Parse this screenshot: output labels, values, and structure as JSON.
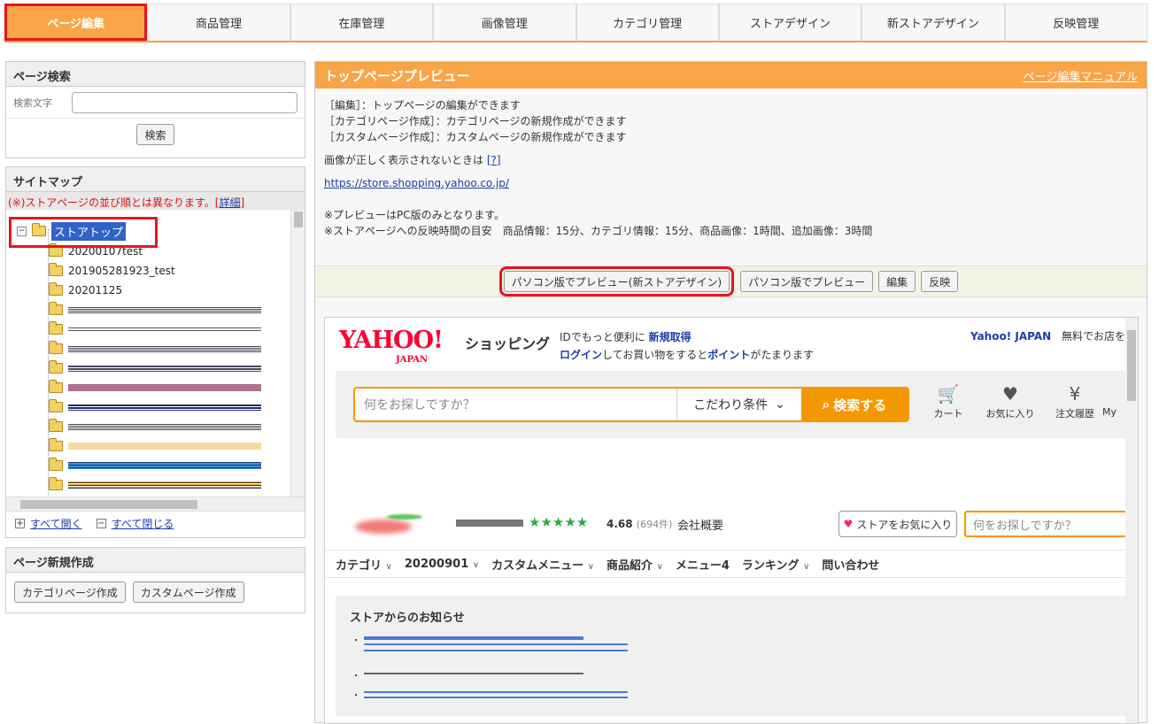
{
  "topnav": {
    "tabs": [
      {
        "label": "ページ編集",
        "active": true
      },
      {
        "label": "商品管理"
      },
      {
        "label": "在庫管理"
      },
      {
        "label": "画像管理"
      },
      {
        "label": "カテゴリ管理"
      },
      {
        "label": "ストアデザイン"
      },
      {
        "label": "新ストアデザイン"
      },
      {
        "label": "反映管理"
      }
    ]
  },
  "page_search": {
    "title": "ページ検索",
    "label": "検索文字",
    "input_value": "",
    "button": "検索"
  },
  "sitemap": {
    "title": "サイトマップ",
    "warning": "(※)ストアページの並び順とは異なります。",
    "detail_link": "詳細",
    "root": "ストアトップ",
    "items": [
      "20200107test",
      "201905281923_test",
      "20201125"
    ],
    "expand_all": "すべて開く",
    "collapse_all": "すべて閉じる"
  },
  "new_page": {
    "title": "ページ新規作成",
    "category_btn": "カテゴリページ作成",
    "custom_btn": "カスタムページ作成"
  },
  "preview": {
    "title": "トップページプレビュー",
    "manual_link": "ページ編集マニュアル",
    "info": [
      "［編集］：トップページの編集ができます",
      "［カテゴリページ作成］：カテゴリページの新規作成ができます",
      "［カスタムページ作成］：カスタムページの新規作成ができます"
    ],
    "image_note": "画像が正しく表示されないときは",
    "image_help": "[?]",
    "store_url": "https://store.shopping.yahoo.co.jp/",
    "notes": [
      "※プレビューはPC版のみとなります。",
      "※ストアページへの反映時間の目安　商品情報：15分、カテゴリ情報：15分、商品画像：1時間、追加画像：3時間"
    ],
    "buttons": {
      "pc_new": "パソコン版でプレビュー(新ストアデザイン)",
      "pc": "パソコン版でプレビュー",
      "edit": "編集",
      "publish": "反映"
    }
  },
  "yahoo": {
    "logo": "YAHOO!",
    "japan": "JAPAN",
    "shopping": "ショッピング",
    "promo_1a": "IDでもっと便利に ",
    "promo_1b": "新規取得",
    "promo_2a": "ログイン",
    "promo_2b": "してお買い物をすると",
    "promo_2c": "ポイント",
    "promo_2d": "がたまります",
    "yj_link": "Yahoo! JAPAN",
    "open_store": "無料でお店を",
    "search_placeholder": "何をお探しですか？",
    "condition": "こだわり条件",
    "search_btn": "検索する",
    "icons": [
      {
        "name": "cart-icon",
        "label": "カート"
      },
      {
        "name": "heart-icon",
        "label": "お気に入り"
      },
      {
        "name": "history-icon",
        "label": "注文履歴"
      },
      {
        "name": "my-icon",
        "label": "My"
      }
    ],
    "store_rating": "4.68",
    "store_reviews": "(694件)",
    "company": "会社概要",
    "fav_store": "ストアをお気に入り",
    "store_search_placeholder": "何をお探しですか？",
    "nav": [
      {
        "label": "カテゴリ",
        "dropdown": true
      },
      {
        "label": "20200901",
        "dropdown": true
      },
      {
        "label": "カスタムメニュー",
        "dropdown": true
      },
      {
        "label": "商品紹介",
        "dropdown": true
      },
      {
        "label": "メニュー4",
        "dropdown": false
      },
      {
        "label": "ランキング",
        "dropdown": true
      },
      {
        "label": "問い合わせ",
        "dropdown": false
      }
    ],
    "news_title": "ストアからのお知らせ"
  }
}
